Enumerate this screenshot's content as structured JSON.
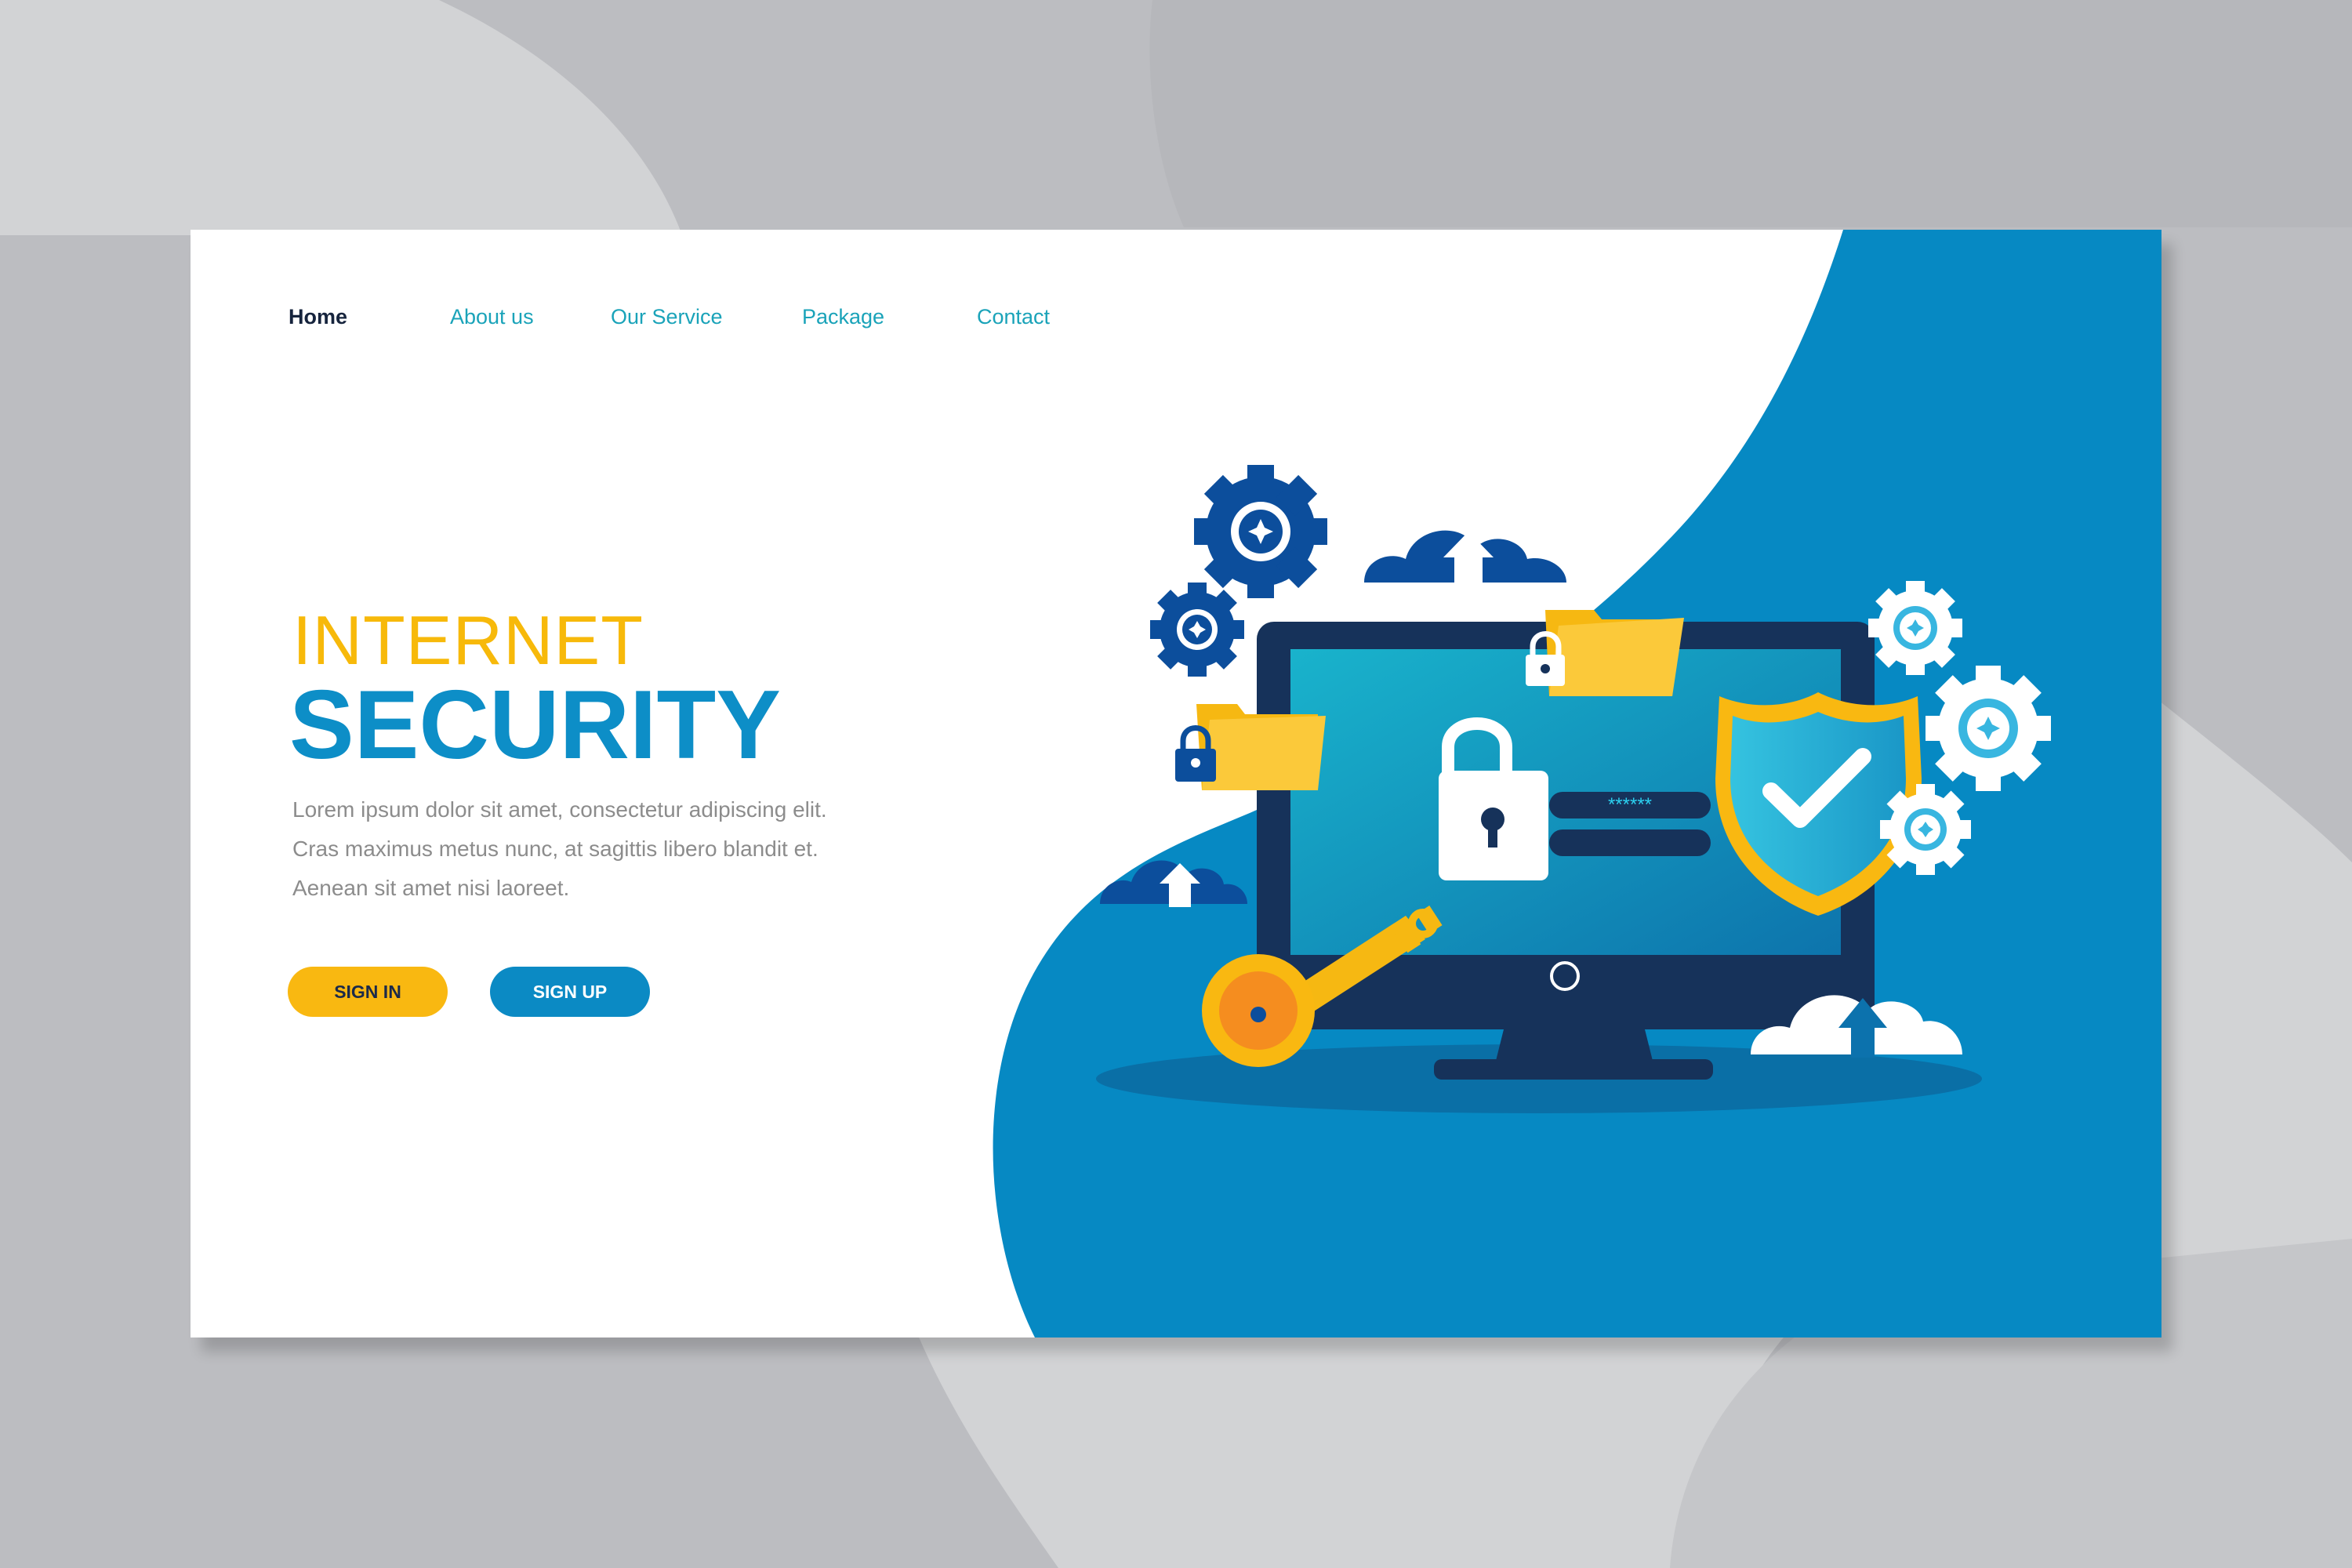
{
  "nav": {
    "items": [
      {
        "label": "Home"
      },
      {
        "label": "About us"
      },
      {
        "label": "Our Service"
      },
      {
        "label": "Package"
      },
      {
        "label": "Contact"
      }
    ]
  },
  "hero": {
    "title_line1": "INTERNET",
    "title_line2": "SECURITY",
    "description": [
      "Lorem ipsum dolor sit amet, consectetur adipiscing elit.",
      "Cras maximus metus nunc, at sagittis libero blandit et.",
      "Aenean sit amet nisi laoreet."
    ]
  },
  "buttons": {
    "signin": "SIGN IN",
    "signup": "SIGN UP"
  },
  "screen": {
    "password_mask": "******"
  },
  "colors": {
    "background": "#bcbdc1",
    "accent_yellow": "#f9b811",
    "accent_blue": "#0b8ac4",
    "dark_navy": "#16243d"
  }
}
